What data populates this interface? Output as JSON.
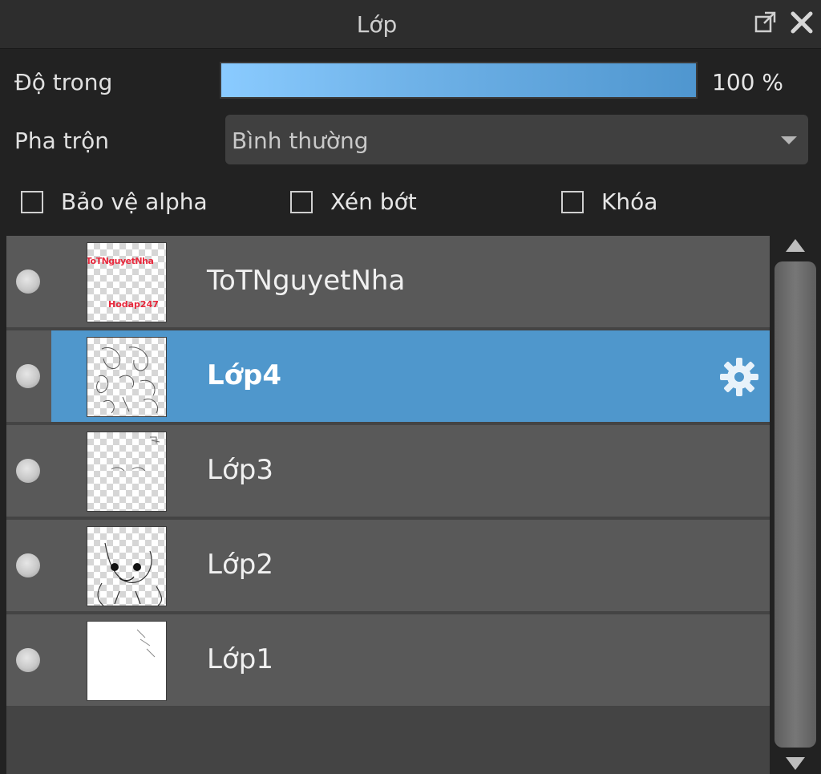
{
  "panel": {
    "title": "Lớp"
  },
  "opacity": {
    "label": "Độ trong",
    "value_text": "100 %",
    "value": 100
  },
  "blend": {
    "label": "Pha trộn",
    "selected": "Bình thường"
  },
  "options": [
    {
      "label": "Bảo vệ alpha",
      "checked": false
    },
    {
      "label": "Xén bớt",
      "checked": false
    },
    {
      "label": "Khóa",
      "checked": false
    }
  ],
  "layers": [
    {
      "name": "ToTNguyetNha",
      "thumb_text_top": "ToTNguyetNha",
      "thumb_text_bottom": "Hodap247",
      "selected": false
    },
    {
      "name": "Lớp4",
      "selected": true
    },
    {
      "name": "Lớp3",
      "selected": false
    },
    {
      "name": "Lớp2",
      "selected": false
    },
    {
      "name": "Lớp1",
      "selected": false
    }
  ],
  "icons": {
    "popout": "popout-icon",
    "close": "close-icon",
    "settings": "gear-icon",
    "visibility": "visibility-dot-icon"
  },
  "colors": {
    "selected_row": "#4f97cc",
    "slider_start": "#8acbff",
    "slider_end": "#4f96cf",
    "thumb_text": "#e8283c"
  }
}
